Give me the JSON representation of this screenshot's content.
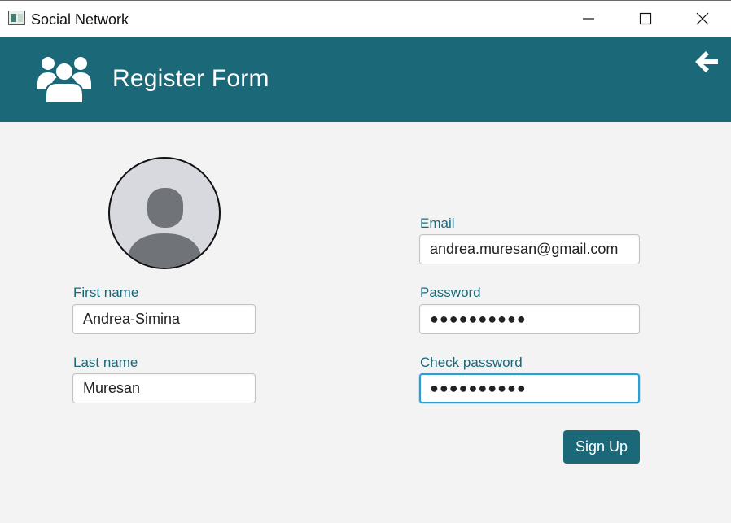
{
  "window": {
    "title": "Social Network",
    "icons": [
      "app-icon",
      "minimize-icon",
      "maximize-icon",
      "close-icon"
    ]
  },
  "header": {
    "title": "Register Form",
    "icon": "users-group-icon",
    "back_icon": "arrow-left-icon",
    "background": "#1a6878"
  },
  "avatar": {
    "icon": "user-avatar-icon"
  },
  "form": {
    "first_name": {
      "label": "First name",
      "value": "Andrea-Simina"
    },
    "last_name": {
      "label": "Last name",
      "value": "Muresan"
    },
    "email": {
      "label": "Email",
      "value": "andrea.muresan@gmail.com"
    },
    "password": {
      "label": "Password",
      "value": "●●●●●●●●●●"
    },
    "check_password": {
      "label": "Check password",
      "value": "●●●●●●●●●●",
      "focused": true
    }
  },
  "signup_button": {
    "label": "Sign Up"
  },
  "colors": {
    "accent": "#1a6878",
    "background": "#f3f3f3",
    "focus_border": "#2a9fd6"
  }
}
